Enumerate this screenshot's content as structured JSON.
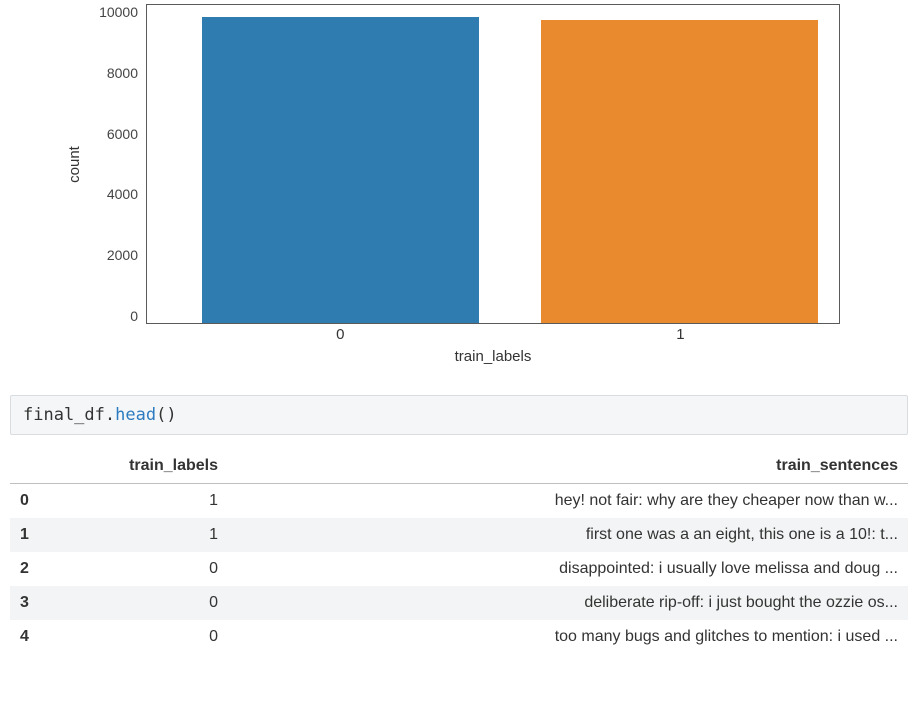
{
  "chart_data": {
    "type": "bar",
    "categories": [
      "0",
      "1"
    ],
    "values": [
      10050,
      9950
    ],
    "ylabel": "count",
    "xlabel": "train_labels",
    "yticks": [
      "10000",
      "8000",
      "6000",
      "4000",
      "2000",
      "0"
    ],
    "ylim": [
      0,
      10500
    ],
    "colors": [
      "#2f7db0",
      "#e98a2e"
    ]
  },
  "code_cell": {
    "ident": "final_df",
    "method": "head"
  },
  "table": {
    "columns": {
      "c0": "train_labels",
      "c1": "train_sentences"
    },
    "rows": [
      {
        "idx": "0",
        "label": "1",
        "sent": "hey! not fair: why are they cheaper now than w..."
      },
      {
        "idx": "1",
        "label": "1",
        "sent": "first one was a an eight, this one is a 10!: t..."
      },
      {
        "idx": "2",
        "label": "0",
        "sent": "disappointed: i usually love melissa and doug ..."
      },
      {
        "idx": "3",
        "label": "0",
        "sent": "deliberate rip-off: i just bought the ozzie os..."
      },
      {
        "idx": "4",
        "label": "0",
        "sent": "too many bugs and glitches to mention: i used ..."
      }
    ]
  }
}
